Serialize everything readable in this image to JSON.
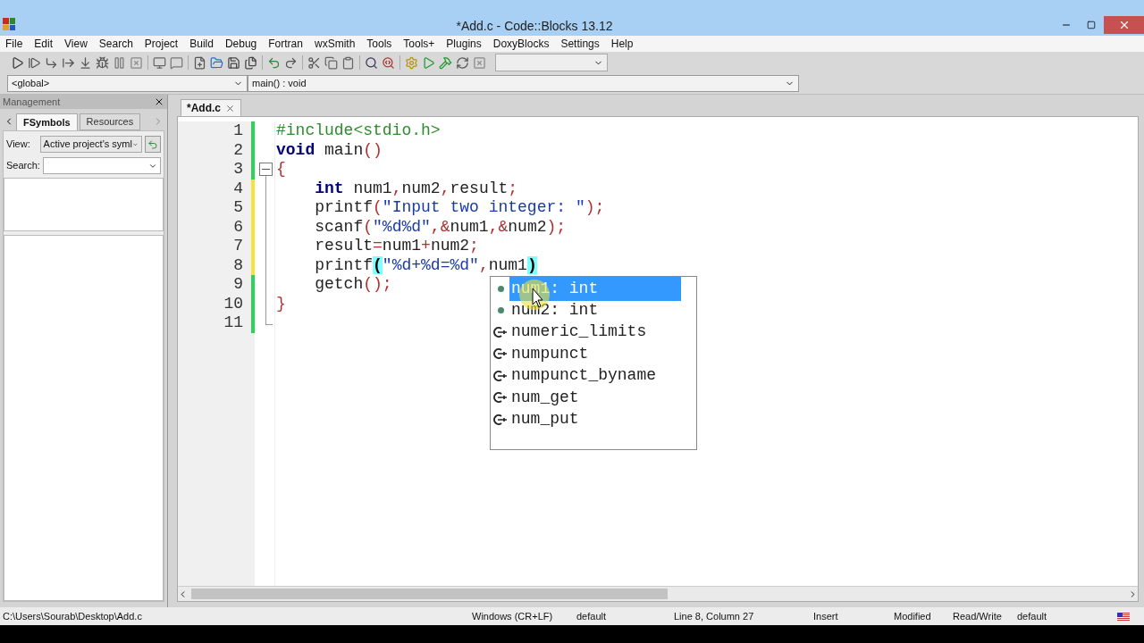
{
  "window": {
    "title": "*Add.c - Code::Blocks 13.12"
  },
  "menu": [
    "File",
    "Edit",
    "View",
    "Search",
    "Project",
    "Build",
    "Debug",
    "Fortran",
    "wxSmith",
    "Tools",
    "Tools+",
    "Plugins",
    "DoxyBlocks",
    "Settings",
    "Help"
  ],
  "scope_bar": {
    "scope": "<global>",
    "function": "main() : void"
  },
  "management": {
    "title": "Management",
    "tabs": [
      {
        "label": "FSymbols",
        "selected": true
      },
      {
        "label": "Resources",
        "selected": false
      }
    ],
    "view_label": "View:",
    "view_value": "Active project's syml",
    "search_label": "Search:"
  },
  "editor": {
    "tabs": [
      {
        "label": "*Add.c",
        "selected": true
      }
    ],
    "lines": [
      {
        "number": "1",
        "modified": false,
        "tokens": [
          {
            "kind": "preproc",
            "text": "#include<stdio.h>"
          }
        ]
      },
      {
        "number": "2",
        "modified": false,
        "tokens": [
          {
            "kind": "keyword",
            "text": "void"
          },
          {
            "kind": "plain",
            "text": " main"
          },
          {
            "kind": "op",
            "text": "()"
          }
        ]
      },
      {
        "number": "3",
        "modified": false,
        "tokens": [
          {
            "kind": "op",
            "text": "{"
          }
        ]
      },
      {
        "number": "4",
        "modified": true,
        "tokens": [
          {
            "kind": "keyword",
            "text": "    int"
          },
          {
            "kind": "plain",
            "text": " num1"
          },
          {
            "kind": "op",
            "text": ","
          },
          {
            "kind": "plain",
            "text": "num2"
          },
          {
            "kind": "op",
            "text": ","
          },
          {
            "kind": "plain",
            "text": "result"
          },
          {
            "kind": "op",
            "text": ";"
          }
        ]
      },
      {
        "number": "5",
        "modified": true,
        "tokens": [
          {
            "kind": "plain",
            "text": "    printf"
          },
          {
            "kind": "op",
            "text": "("
          },
          {
            "kind": "string",
            "text": "\"Input two integer: \""
          },
          {
            "kind": "op",
            "text": ");"
          }
        ]
      },
      {
        "number": "6",
        "modified": true,
        "tokens": [
          {
            "kind": "plain",
            "text": "    scanf"
          },
          {
            "kind": "op",
            "text": "("
          },
          {
            "kind": "string",
            "text": "\"%d%d\""
          },
          {
            "kind": "op",
            "text": ",&"
          },
          {
            "kind": "plain",
            "text": "num1"
          },
          {
            "kind": "op",
            "text": ",&"
          },
          {
            "kind": "plain",
            "text": "num2"
          },
          {
            "kind": "op",
            "text": ");"
          }
        ]
      },
      {
        "number": "7",
        "modified": true,
        "tokens": [
          {
            "kind": "plain",
            "text": "    result"
          },
          {
            "kind": "op",
            "text": "="
          },
          {
            "kind": "plain",
            "text": "num1"
          },
          {
            "kind": "op",
            "text": "+"
          },
          {
            "kind": "plain",
            "text": "num2"
          },
          {
            "kind": "op",
            "text": ";"
          }
        ]
      },
      {
        "number": "8",
        "modified": true,
        "tokens": [
          {
            "kind": "plain",
            "text": "    printf"
          },
          {
            "kind": "brace",
            "text": "("
          },
          {
            "kind": "string",
            "text": "\"%d+%d=%d\""
          },
          {
            "kind": "op",
            "text": ","
          },
          {
            "kind": "plain",
            "text": "num1"
          },
          {
            "kind": "brace",
            "text": ")"
          }
        ]
      },
      {
        "number": "9",
        "modified": false,
        "tokens": [
          {
            "kind": "plain",
            "text": "    getch"
          },
          {
            "kind": "op",
            "text": "();"
          }
        ]
      },
      {
        "number": "10",
        "modified": false,
        "tokens": [
          {
            "kind": "op",
            "text": "}"
          }
        ]
      },
      {
        "number": "11",
        "modified": false
      }
    ],
    "completion": [
      {
        "kind": "variable",
        "text": "num1: int",
        "selected": true
      },
      {
        "kind": "variable",
        "text": "num2: int",
        "selected": false
      },
      {
        "kind": "class",
        "text": "numeric_limits",
        "selected": false
      },
      {
        "kind": "class",
        "text": "numpunct",
        "selected": false
      },
      {
        "kind": "class",
        "text": "numpunct_byname",
        "selected": false
      },
      {
        "kind": "class",
        "text": "num_get",
        "selected": false
      },
      {
        "kind": "class",
        "text": "num_put",
        "selected": false
      }
    ]
  },
  "status_bar": [
    "C:\\Users\\Sourab\\Desktop\\Add.c",
    "Windows (CR+LF)",
    "default",
    "Line 8, Column 27",
    "Insert",
    "Modified",
    "Read/Write",
    "default"
  ]
}
